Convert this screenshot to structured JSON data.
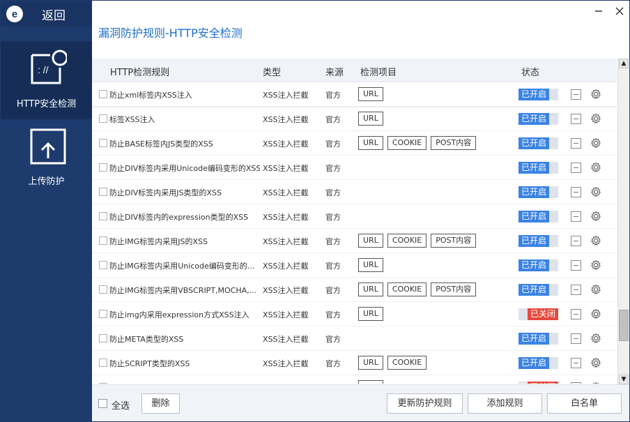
{
  "sidebar": {
    "logo_letter": "e",
    "back_label": "返回",
    "items": [
      {
        "label": "HTTP安全检测",
        "icon": "shield-code-icon"
      },
      {
        "label": "上传防护",
        "icon": "upload-icon"
      }
    ]
  },
  "page": {
    "title": "漏洞防护规则-HTTP安全检测"
  },
  "table": {
    "headers": {
      "rule": "HTTP检测规则",
      "type": "类型",
      "source": "来源",
      "items": "检测项目",
      "status": "状态"
    },
    "rows": [
      {
        "name": "防止xml标签内XSS注入",
        "type": "XSS注入拦截",
        "source": "官方",
        "tags": [
          "URL"
        ],
        "status": "已开启",
        "on": true
      },
      {
        "name": "标签XSS注入",
        "type": "XSS注入拦截",
        "source": "官方",
        "tags": [
          "URL"
        ],
        "status": "已开启",
        "on": true
      },
      {
        "name": "防止BASE标签内JS类型的XSS",
        "type": "XSS注入拦截",
        "source": "官方",
        "tags": [
          "URL",
          "COOKIE",
          "POST内容"
        ],
        "status": "已开启",
        "on": true
      },
      {
        "name": "防止DIV标签内采用Unicode编码变形的XSS",
        "type": "XSS注入拦截",
        "source": "官方",
        "tags": [],
        "status": "已开启",
        "on": true
      },
      {
        "name": "防止DIV标签内采用JS类型的XSS",
        "type": "XSS注入拦截",
        "source": "官方",
        "tags": [],
        "status": "已开启",
        "on": true
      },
      {
        "name": "防止DIV标签内的expression类型的XSS",
        "type": "XSS注入拦截",
        "source": "官方",
        "tags": [],
        "status": "已开启",
        "on": true
      },
      {
        "name": "防止IMG标签内采用JS的XSS",
        "type": "XSS注入拦截",
        "source": "官方",
        "tags": [
          "URL",
          "COOKIE",
          "POST内容"
        ],
        "status": "已开启",
        "on": true
      },
      {
        "name": "防止IMG标签内采用Unicode编码变形的...",
        "type": "XSS注入拦截",
        "source": "官方",
        "tags": [
          "URL"
        ],
        "status": "已开启",
        "on": true
      },
      {
        "name": "防止IMG标签内采用VBSCRIPT,MOCHA,...",
        "type": "XSS注入拦截",
        "source": "官方",
        "tags": [
          "URL",
          "COOKIE",
          "POST内容"
        ],
        "status": "已开启",
        "on": true
      },
      {
        "name": "防止img内采用expression方式XSS注入",
        "type": "XSS注入拦截",
        "source": "官方",
        "tags": [
          "URL"
        ],
        "status": "已关闭",
        "on": false
      },
      {
        "name": "防止META类型的XSS",
        "type": "XSS注入拦截",
        "source": "官方",
        "tags": [],
        "status": "已开启",
        "on": true
      },
      {
        "name": "防止SCRIPT类型的XSS",
        "type": "XSS注入拦截",
        "source": "官方",
        "tags": [
          "URL",
          "COOKIE"
        ],
        "status": "已开启",
        "on": true
      },
      {
        "name": "防止image方式XSS注入",
        "type": "XSS注入拦截",
        "source": "官方",
        "tags": [
          "URL"
        ],
        "status": "已关闭",
        "on": false
      }
    ]
  },
  "footer": {
    "select_all": "全选",
    "delete": "删除",
    "update_rules": "更新防护规则",
    "add_rule": "添加规则",
    "whitelist": "白名单"
  },
  "colors": {
    "sidebar": "#1e3b6e",
    "title": "#1e6fc6",
    "on": "#3a83e4",
    "off": "#e44a3e"
  }
}
